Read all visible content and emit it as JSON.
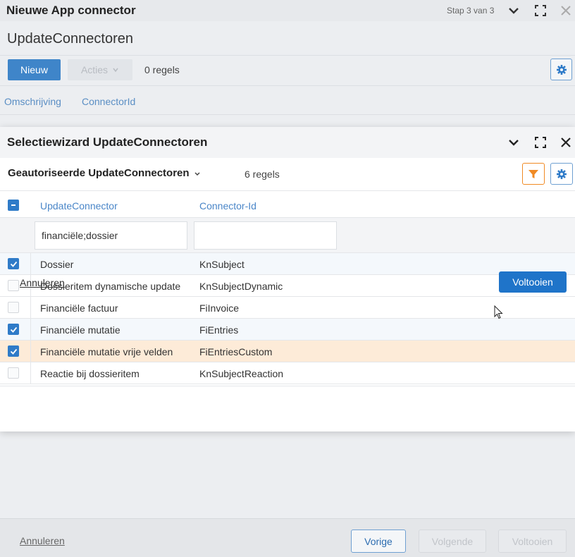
{
  "outer": {
    "title": "Nieuwe App connector",
    "step": "Stap 3 van 3",
    "subtitle": "UpdateConnectoren",
    "new_label": "Nieuw",
    "actions_label": "Acties",
    "count": "0 regels",
    "columns": [
      "Omschrijving",
      "ConnectorId"
    ],
    "footer": {
      "cancel": "Annuleren",
      "prev": "Vorige",
      "next": "Volgende",
      "finish": "Voltooien"
    }
  },
  "dialog": {
    "title": "Selectiewizard UpdateConnectoren",
    "view_label": "Geautoriseerde UpdateConnectoren",
    "count": "6 regels",
    "columns": [
      "UpdateConnector",
      "Connector-Id"
    ],
    "filter_values": [
      "financiële;dossier",
      ""
    ],
    "rows": [
      {
        "name": "Dossier",
        "id": "KnSubject",
        "checked": true
      },
      {
        "name": "Dossieritem dynamische update",
        "id": "KnSubjectDynamic",
        "checked": false
      },
      {
        "name": "Financiële factuur",
        "id": "FiInvoice",
        "checked": false
      },
      {
        "name": "Financiële mutatie",
        "id": "FiEntries",
        "checked": true
      },
      {
        "name": "Financiële mutatie vrije velden",
        "id": "FiEntriesCustom",
        "checked": true
      },
      {
        "name": "Reactie bij dossieritem",
        "id": "KnSubjectReaction",
        "checked": false
      }
    ],
    "footer": {
      "cancel": "Annuleren",
      "finish": "Voltooien"
    }
  },
  "colors": {
    "primary": "#1f74c9",
    "link": "#4a86c8",
    "filter_accent": "#f08a24",
    "focus_row": "#fdebd8"
  }
}
